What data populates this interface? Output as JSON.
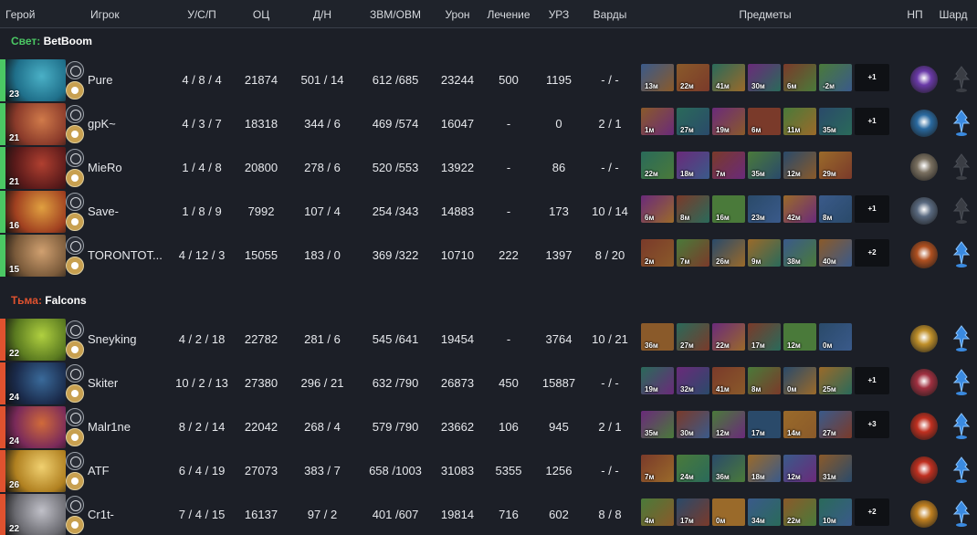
{
  "headers": {
    "hero": "Герой",
    "player": "Игрок",
    "kda": "У/С/П",
    "nw": "ОЦ",
    "lhdn": "Д/Н",
    "gpmxpm": "ЗВМ/ОВМ",
    "damage": "Урон",
    "heal": "Лечение",
    "bld": "УРЗ",
    "wards": "Варды",
    "items": "Предметы",
    "np": "НП",
    "shard": "Шард"
  },
  "teams": [
    {
      "side": "Свет:",
      "name": "BetBoom",
      "accent": "#4bc864",
      "players": [
        {
          "level": "23",
          "player": "Pure",
          "kda": "4 / 8 / 4",
          "nw": "21874",
          "lhdn": "501 / 14",
          "gpmxpm": "612 /685",
          "damage": "23244",
          "heal": "500",
          "bld": "1195",
          "wards": "- / -",
          "items": [
            "13м",
            "22м",
            "41м",
            "30м",
            "6м",
            "-2м"
          ],
          "more": "+1",
          "shard": false,
          "hero_colors": [
            "#1f6f8a",
            "#4ab0c6"
          ],
          "np_color": "#6a3aa8"
        },
        {
          "level": "21",
          "player": "gpK~",
          "kda": "4 / 3 / 7",
          "nw": "18318",
          "lhdn": "344 / 6",
          "gpmxpm": "469 /574",
          "damage": "16047",
          "heal": "-",
          "bld": "0",
          "wards": "2 / 1",
          "items": [
            "1м",
            "27м",
            "19м",
            "6м",
            "11м",
            "35м"
          ],
          "more": "+1",
          "shard": true,
          "hero_colors": [
            "#8a3a2a",
            "#d07a4a"
          ],
          "np_color": "#2a6aa0"
        },
        {
          "level": "21",
          "player": "MieRo",
          "kda": "1 / 4 / 8",
          "nw": "20800",
          "lhdn": "278 / 6",
          "gpmxpm": "520 /553",
          "damage": "13922",
          "heal": "-",
          "bld": "86",
          "wards": "- / -",
          "items": [
            "22м",
            "18м",
            "7м",
            "35м",
            "12м",
            "29м"
          ],
          "more": "",
          "shard": false,
          "hero_colors": [
            "#5a1a1a",
            "#b04030"
          ],
          "np_color": "#7a7060"
        },
        {
          "level": "16",
          "player": "Save-",
          "kda": "1 / 8 / 9",
          "nw": "7992",
          "lhdn": "107 / 4",
          "gpmxpm": "254 /343",
          "damage": "14883",
          "heal": "-",
          "bld": "173",
          "wards": "10 / 14",
          "items": [
            "6м",
            "8м",
            "16м",
            "23м",
            "42м",
            "8м"
          ],
          "more": "+1",
          "shard": false,
          "hero_colors": [
            "#a04020",
            "#e0a040"
          ],
          "np_color": "#5a6a80"
        },
        {
          "level": "15",
          "player": "TORONTOT...",
          "kda": "4 / 12 / 3",
          "nw": "15055",
          "lhdn": "183 / 0",
          "gpmxpm": "369 /322",
          "damage": "10710",
          "heal": "222",
          "bld": "1397",
          "wards": "8 / 20",
          "items": [
            "2м",
            "7м",
            "26м",
            "9м",
            "38м",
            "40м"
          ],
          "more": "+2",
          "shard": true,
          "hero_colors": [
            "#7a5a3a",
            "#d0a070"
          ],
          "np_color": "#b05020"
        }
      ]
    },
    {
      "side": "Тьма:",
      "name": "Falcons",
      "accent": "#e0522f",
      "players": [
        {
          "level": "22",
          "player": "Sneyking",
          "kda": "4 / 2 / 18",
          "nw": "22782",
          "lhdn": "281 / 6",
          "gpmxpm": "545 /641",
          "damage": "19454",
          "heal": "-",
          "bld": "3764",
          "wards": "10 / 21",
          "items": [
            "36м",
            "27м",
            "22м",
            "17м",
            "12м",
            "0м"
          ],
          "more": "",
          "shard": true,
          "hero_colors": [
            "#5a7a20",
            "#b0d040"
          ],
          "np_color": "#c0902a"
        },
        {
          "level": "24",
          "player": "Skiter",
          "kda": "10 / 2 / 13",
          "nw": "27380",
          "lhdn": "296 / 21",
          "gpmxpm": "632 /790",
          "damage": "26873",
          "heal": "450",
          "bld": "15887",
          "wards": "- / -",
          "items": [
            "19м",
            "32м",
            "41м",
            "8м",
            "0м",
            "25м"
          ],
          "more": "+1",
          "shard": true,
          "hero_colors": [
            "#1a2a4a",
            "#3a6a9a"
          ],
          "np_color": "#a03040"
        },
        {
          "level": "24",
          "player": "Malr1ne",
          "kda": "8 / 2 / 14",
          "nw": "22042",
          "lhdn": "268 / 4",
          "gpmxpm": "579 /790",
          "damage": "23662",
          "heal": "106",
          "bld": "945",
          "wards": "2 / 1",
          "items": [
            "35м",
            "30м",
            "12м",
            "17м",
            "14м",
            "27м"
          ],
          "more": "+3",
          "shard": true,
          "hero_colors": [
            "#7a2a5a",
            "#d06a3a"
          ],
          "np_color": "#c03020"
        },
        {
          "level": "26",
          "player": "ATF",
          "kda": "6 / 4 / 19",
          "nw": "27073",
          "lhdn": "383 / 7",
          "gpmxpm": "658 /1003",
          "damage": "31083",
          "heal": "5355",
          "bld": "1256",
          "wards": "- / -",
          "items": [
            "7м",
            "24м",
            "36м",
            "18м",
            "12м",
            "31м"
          ],
          "more": "",
          "shard": true,
          "hero_colors": [
            "#b08020",
            "#f0d070"
          ],
          "np_color": "#c03020"
        },
        {
          "level": "22",
          "player": "Cr1t-",
          "kda": "7 / 4 / 15",
          "nw": "16137",
          "lhdn": "97 / 2",
          "gpmxpm": "401 /607",
          "damage": "19814",
          "heal": "716",
          "bld": "602",
          "wards": "8 / 8",
          "items": [
            "4м",
            "17м",
            "0м",
            "34м",
            "22м",
            "10м"
          ],
          "more": "+2",
          "shard": true,
          "hero_colors": [
            "#6a6a70",
            "#c0c0c8"
          ],
          "np_color": "#c08020"
        }
      ]
    }
  ],
  "item_palette": [
    "#3a5a8a",
    "#8a5a2a",
    "#2a6a5a",
    "#6a2a7a",
    "#7a3a2a",
    "#4a7a3a",
    "#2a4a6a",
    "#9a6a2a"
  ]
}
